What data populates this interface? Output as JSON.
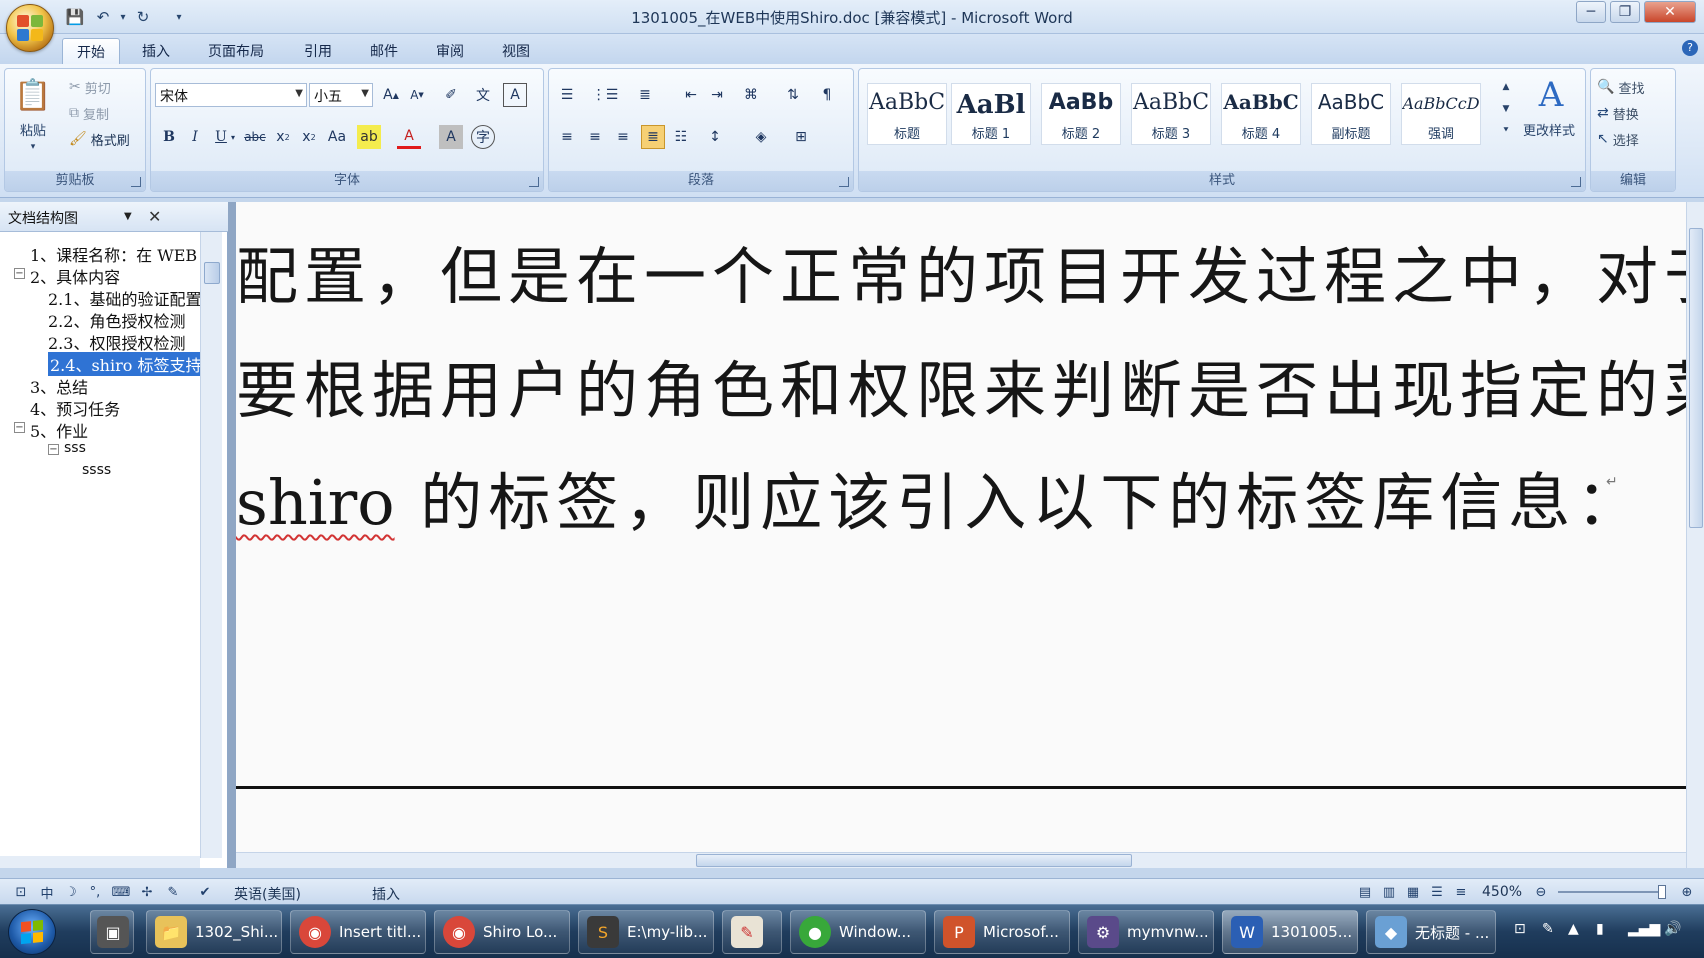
{
  "window": {
    "title": "1301005_在WEB中使用Shiro.doc [兼容模式] - Microsoft Word",
    "controls": {
      "minimize": "─",
      "restore": "❐",
      "close": "✕"
    }
  },
  "quick_access": [
    "save-icon",
    "undo-icon",
    "redo-icon",
    "customize-icon"
  ],
  "ribbon_tabs": [
    "开始",
    "插入",
    "页面布局",
    "引用",
    "邮件",
    "审阅",
    "视图"
  ],
  "ribbon": {
    "clipboard": {
      "label": "剪贴板",
      "paste": "粘贴",
      "cut": "剪切",
      "copy": "复制",
      "format_painter": "格式刷"
    },
    "font": {
      "label": "字体",
      "font_name": "宋体",
      "font_size": "小五"
    },
    "paragraph": {
      "label": "段落"
    },
    "styles": {
      "label": "样式",
      "tiles": [
        {
          "sample": "AaBbC",
          "name": "标题"
        },
        {
          "sample": "AaBl",
          "name": "标题 1"
        },
        {
          "sample": "AaBb",
          "name": "标题 2"
        },
        {
          "sample": "AaBbC",
          "name": "标题 3"
        },
        {
          "sample": "AaBbC",
          "name": "标题 4"
        },
        {
          "sample": "AaBbC",
          "name": "副标题"
        },
        {
          "sample": "AaBbCcD",
          "name": "强调"
        }
      ],
      "change_styles": "更改样式"
    },
    "editing": {
      "label": "编辑",
      "find": "查找",
      "replace": "替换",
      "select": "选择"
    }
  },
  "nav_pane": {
    "view_select": "文档结构图",
    "items": [
      {
        "text": "1、课程名称：在 WEB",
        "level": 0
      },
      {
        "text": "2、具体内容",
        "level": 0
      },
      {
        "text": "2.1、基础的验证配置",
        "level": 1
      },
      {
        "text": "2.2、角色授权检测",
        "level": 1
      },
      {
        "text": "2.3、权限授权检测",
        "level": 1
      },
      {
        "text": "2.4、shiro 标签支持",
        "level": 1,
        "selected": true
      },
      {
        "text": "3、总结",
        "level": 0
      },
      {
        "text": "4、预习任务",
        "level": 0
      },
      {
        "text": "5、作业",
        "level": 0
      },
      {
        "text": "sss",
        "level": 1
      },
      {
        "text": "ssss",
        "level": 2
      }
    ]
  },
  "document": {
    "line1": "配置，但是在一个正常的项目开发过程之中，对于",
    "line2": "要根据用户的角色和权限来判断是否出现指定的菜",
    "line3_word": "shiro",
    "line3_rest": " 的标签，则应该引入以下的标签库信息：",
    "paragraph_mark": "↵"
  },
  "status_bar": {
    "language": "英语(美国)",
    "mode": "插入",
    "zoom": "450%"
  },
  "taskbar": {
    "tasks": [
      {
        "label": "1302_Shi...",
        "icon": "folder-icon",
        "color": "#e8c25a"
      },
      {
        "label": "Insert titl...",
        "icon": "chrome-icon",
        "color": "#d9473a"
      },
      {
        "label": "Shiro Lo...",
        "icon": "chrome-icon",
        "color": "#d9473a"
      },
      {
        "label": "E:\\my-lib...",
        "icon": "sublime-icon",
        "color": "#3a3a3a"
      },
      {
        "label": "",
        "icon": "notepad-icon",
        "color": "#c44"
      },
      {
        "label": "Window...",
        "icon": "wechat-icon",
        "color": "#38a83a"
      },
      {
        "label": "Microsof...",
        "icon": "powerpoint-icon",
        "color": "#d0532b"
      },
      {
        "label": "mymvnw...",
        "icon": "eclipse-icon",
        "color": "#5a4a8a"
      },
      {
        "label": "1301005...",
        "icon": "word-icon",
        "color": "#2b5fb4"
      },
      {
        "label": "无标题 - ...",
        "icon": "paint-icon",
        "color": "#6aa0d4"
      }
    ]
  }
}
